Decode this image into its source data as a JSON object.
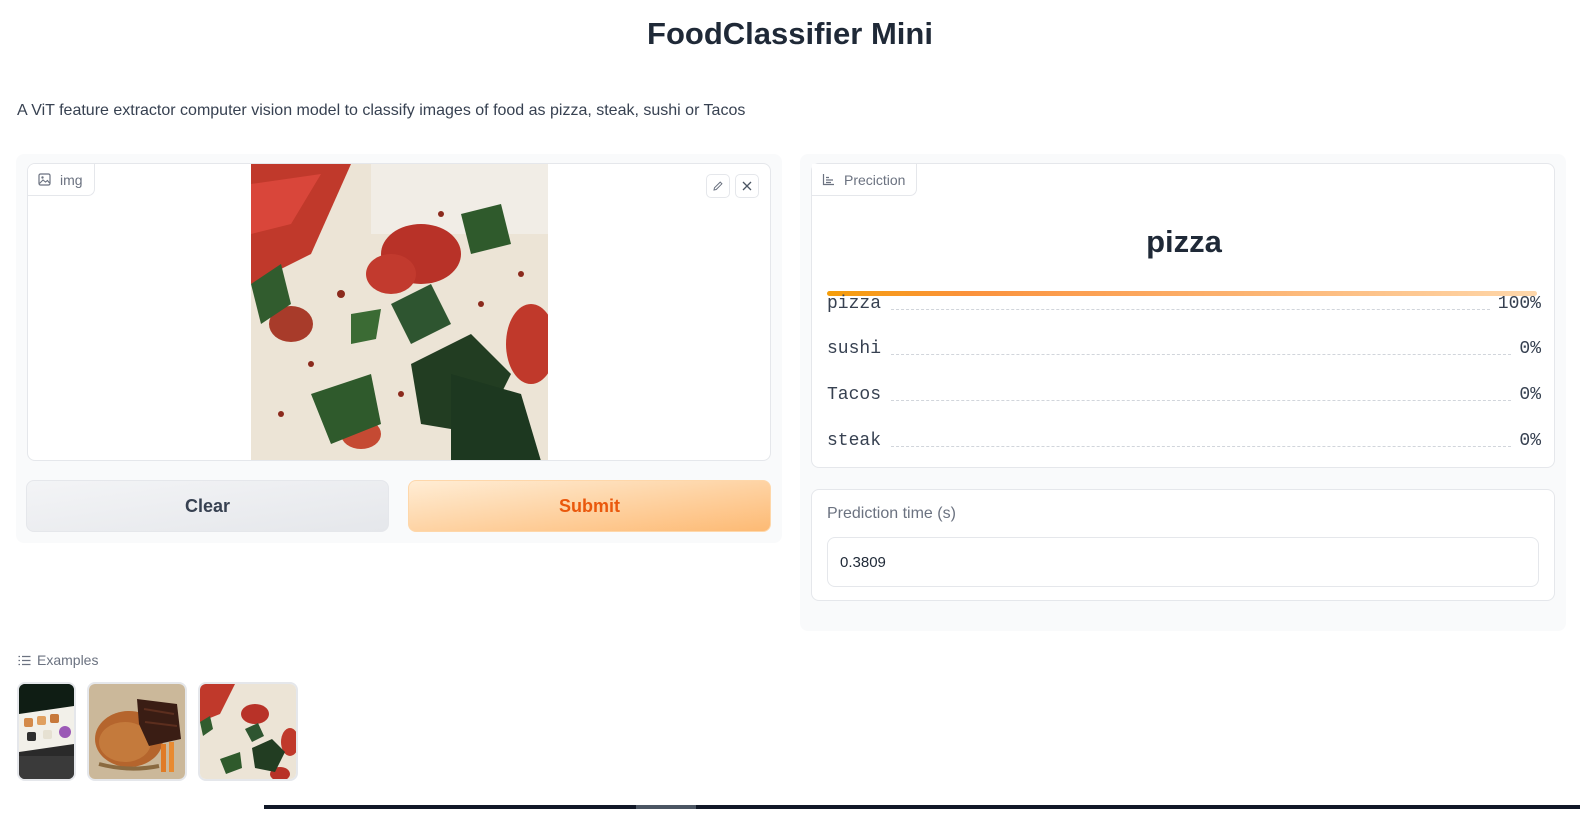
{
  "app": {
    "title": "FoodClassifier Mini",
    "description": "A ViT feature extractor computer vision model to classify images of food as pizza, steak, sushi or Tacos"
  },
  "input": {
    "label": "img",
    "image_icon": "image-icon",
    "edit_icon": "pencil-icon",
    "clear_icon": "close-icon"
  },
  "buttons": {
    "clear": "Clear",
    "submit": "Submit"
  },
  "prediction": {
    "label": "Preciction",
    "top_label": "pizza",
    "top_confidence": 1.0,
    "rows": [
      {
        "label": "pizza",
        "value": "100%"
      },
      {
        "label": "sushi",
        "value": "0%"
      },
      {
        "label": "Tacos",
        "value": "0%"
      },
      {
        "label": "steak",
        "value": "0%"
      }
    ]
  },
  "time": {
    "label": "Prediction time (s)",
    "value": "0.3809"
  },
  "examples": {
    "label": "Examples",
    "items": [
      "sushi-example",
      "steak-example",
      "pizza-example"
    ]
  },
  "colors": {
    "accent": "#f97316",
    "submit_text": "#ea580c"
  }
}
